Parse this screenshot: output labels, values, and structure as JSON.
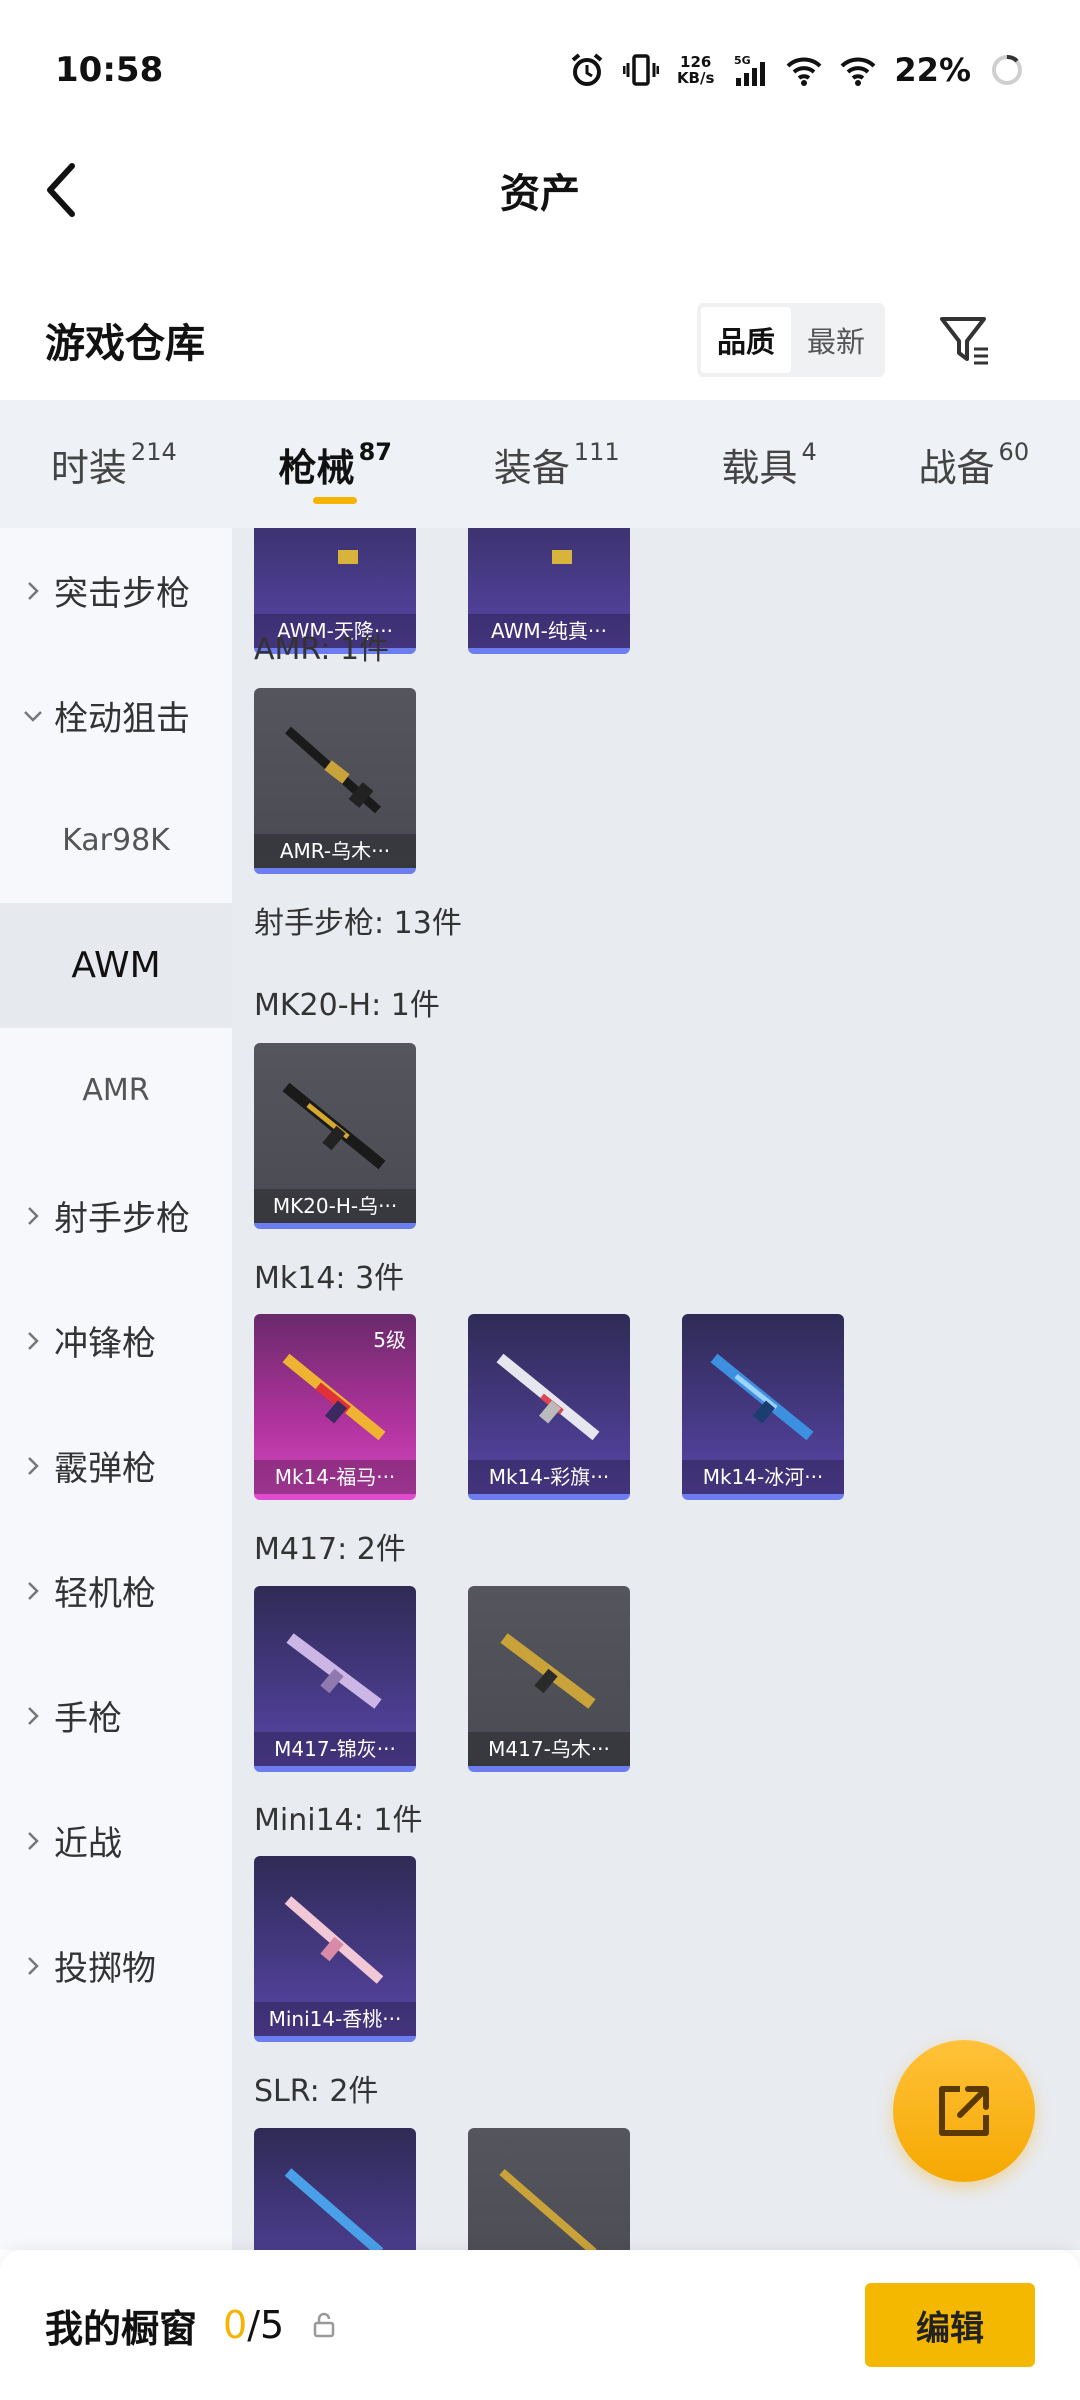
{
  "status": {
    "time": "10:58",
    "net_speed_value": "126",
    "net_speed_unit": "KB/s",
    "network": "5G",
    "battery": "22%"
  },
  "header": {
    "title": "资产"
  },
  "warehouse": {
    "title": "游戏仓库",
    "sort_quality": "品质",
    "sort_newest": "最新"
  },
  "tabs": [
    {
      "label": "时装",
      "count": "214"
    },
    {
      "label": "枪械",
      "count": "87"
    },
    {
      "label": "装备",
      "count": "111"
    },
    {
      "label": "载具",
      "count": "4"
    },
    {
      "label": "战备",
      "count": "60"
    }
  ],
  "sidenav": {
    "items": [
      {
        "label": "突击步枪"
      },
      {
        "label": "栓动狙击"
      },
      {
        "label": "Kar98K"
      },
      {
        "label": "AWM"
      },
      {
        "label": "AMR"
      },
      {
        "label": "射手步枪"
      },
      {
        "label": "冲锋枪"
      },
      {
        "label": "霰弹枪"
      },
      {
        "label": "轻机枪"
      },
      {
        "label": "手枪"
      },
      {
        "label": "近战"
      },
      {
        "label": "投掷物"
      }
    ]
  },
  "content": {
    "top_cards": [
      "AWM-天降···",
      "AWM-纯真···"
    ],
    "groups": [
      {
        "label": "AMR: 1件",
        "cards": [
          {
            "name": "AMR-乌木···",
            "style": "grey"
          }
        ]
      },
      {
        "label": "射手步枪: 13件"
      },
      {
        "label": "MK20-H: 1件",
        "cards": [
          {
            "name": "MK20-H-乌···",
            "style": "grey"
          }
        ]
      },
      {
        "label": "Mk14: 3件",
        "cards": [
          {
            "name": "Mk14-福马···",
            "style": "pink",
            "level": "5级"
          },
          {
            "name": "Mk14-彩旗···",
            "style": "purple"
          },
          {
            "name": "Mk14-冰河···",
            "style": "purple"
          }
        ]
      },
      {
        "label": "M417: 2件",
        "cards": [
          {
            "name": "M417-锦灰···",
            "style": "purple"
          },
          {
            "name": "M417-乌木···",
            "style": "grey"
          }
        ]
      },
      {
        "label": "Mini14: 1件",
        "cards": [
          {
            "name": "Mini14-香桃···",
            "style": "purple"
          }
        ]
      },
      {
        "label": "SLR: 2件"
      }
    ]
  },
  "bottom": {
    "label": "我的橱窗",
    "count_current": "0",
    "count_total": "/5",
    "edit_label": "编辑"
  },
  "colors": {
    "accent": "#f5b400",
    "tab_bg": "#eef2f6",
    "content_bg": "#e8ebf0"
  }
}
